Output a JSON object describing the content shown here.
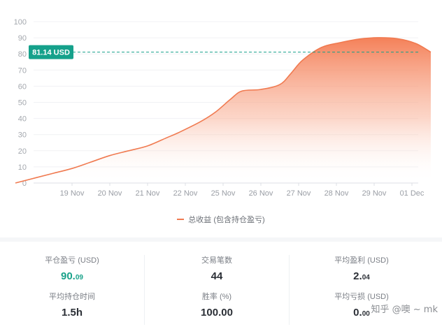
{
  "chart_data": {
    "type": "area",
    "categories": [
      "19 Nov",
      "20 Nov",
      "21 Nov",
      "22 Nov",
      "25 Nov",
      "26 Nov",
      "27 Nov",
      "28 Nov",
      "29 Nov",
      "01 Dec"
    ],
    "y_ticks": [
      "0",
      "10",
      "20",
      "30",
      "40",
      "50",
      "60",
      "70",
      "80",
      "90",
      "100"
    ],
    "ylim": [
      0,
      100
    ],
    "series": [
      {
        "name": "总收益 (包含持仓盈亏)",
        "color": "#f07a50",
        "x": [
          -1.5,
          -0.5,
          0,
          0.5,
          1,
          1.5,
          2,
          2.5,
          2.8,
          3.4,
          3.8,
          4.2,
          4.5,
          5,
          5.5,
          5.8,
          6.1,
          6.6,
          7.1,
          7.6,
          8.1,
          8.6,
          9.1,
          9.5
        ],
        "values": [
          0,
          6,
          9,
          13,
          17,
          20,
          23,
          28,
          31,
          38,
          44,
          52,
          57,
          58,
          61,
          68,
          76,
          84,
          87,
          89.2,
          90.1,
          89.5,
          86.5,
          81.1
        ]
      }
    ],
    "reference_line": {
      "value": 81.14,
      "label": "81.14 USD",
      "color": "#15a18b"
    },
    "legend": "bottom-center",
    "grid": true
  },
  "legend": {
    "label": "总收益 (包含持仓盈亏)"
  },
  "stats": {
    "realized_pnl": {
      "label": "平仓盈亏 (USD)",
      "int": "90.",
      "dec": "09"
    },
    "avg_hold_time": {
      "label": "平均持仓时间",
      "value": "1.5h"
    },
    "trade_count": {
      "label": "交易笔数",
      "value": "44"
    },
    "win_rate": {
      "label": "胜率 (%)",
      "value": "100.00"
    },
    "avg_profit": {
      "label": "平均盈利 (USD)",
      "int": "2.",
      "dec": "04"
    },
    "avg_loss": {
      "label": "平均亏损 (USD)",
      "int": "0.",
      "dec": "00"
    }
  },
  "watermark": {
    "text": "知乎 @噢 ~ mk"
  }
}
